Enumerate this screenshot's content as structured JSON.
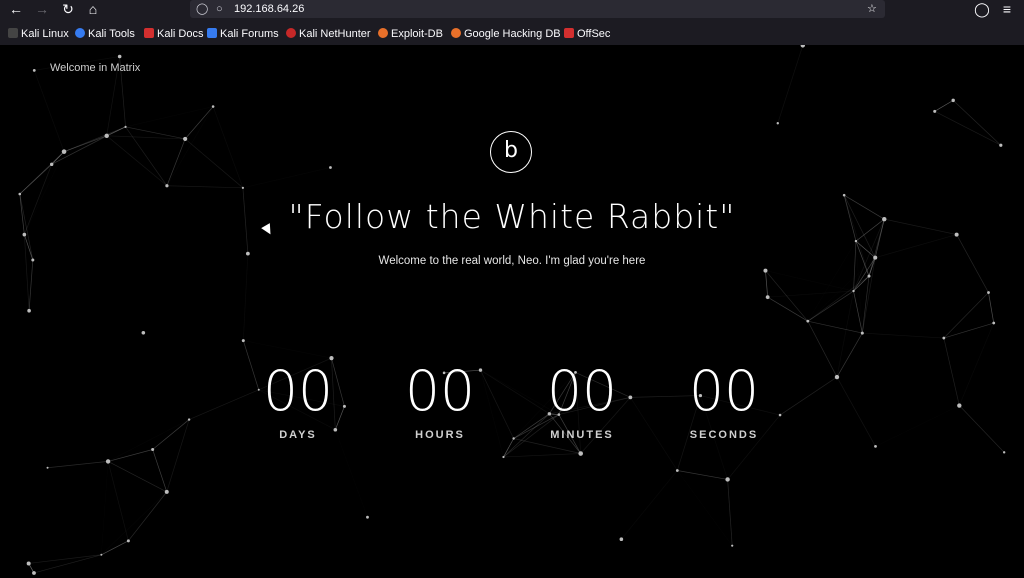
{
  "browser": {
    "url": "192.168.64.26",
    "bookmarks": [
      {
        "label": "Kali Linux",
        "color": "#2a2a2a"
      },
      {
        "label": "Kali Tools",
        "color": "#367bf0"
      },
      {
        "label": "Kali Docs",
        "color": "#d32f2f"
      },
      {
        "label": "Kali Forums",
        "color": "#367bf0"
      },
      {
        "label": "Kali NetHunter",
        "color": "#c62828"
      },
      {
        "label": "Exploit-DB",
        "color": "#e8702a"
      },
      {
        "label": "Google Hacking DB",
        "color": "#e8702a"
      },
      {
        "label": "OffSec",
        "color": "#d32f2f"
      }
    ]
  },
  "page": {
    "corner_text": "Welcome in Matrix",
    "logo": "b",
    "headline": "\"Follow the White Rabbit\"",
    "subline": "Welcome to the real world, Neo. I'm glad you're here",
    "countdown": [
      {
        "value": "00",
        "label": "DAYS"
      },
      {
        "value": "00",
        "label": "HOURS"
      },
      {
        "value": "00",
        "label": "MINUTES"
      },
      {
        "value": "00",
        "label": "SECONDS"
      }
    ]
  }
}
